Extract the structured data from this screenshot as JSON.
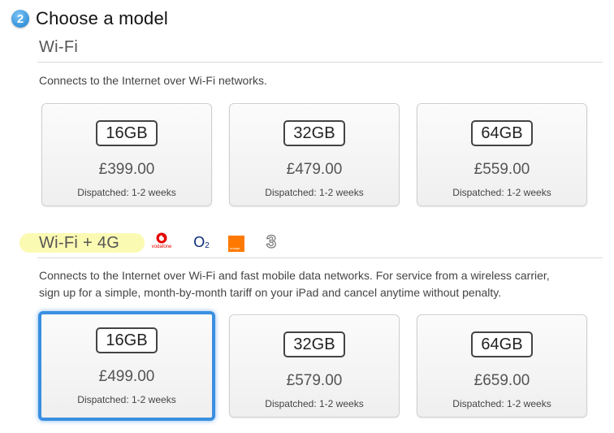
{
  "step": {
    "number": "2",
    "title": "Choose a model"
  },
  "wifi": {
    "title": "Wi-Fi",
    "description": "Connects to the Internet over Wi-Fi networks.",
    "models": [
      {
        "capacity": "16GB",
        "price": "£399.00",
        "dispatch": "Dispatched: 1-2 weeks"
      },
      {
        "capacity": "32GB",
        "price": "£479.00",
        "dispatch": "Dispatched: 1-2 weeks"
      },
      {
        "capacity": "64GB",
        "price": "£559.00",
        "dispatch": "Dispatched: 1-2 weeks"
      }
    ]
  },
  "cellular": {
    "title": "Wi-Fi + 4G",
    "description_line1": "Connects to the Internet over Wi-Fi and fast mobile data networks. For service from a wireless carrier,",
    "description_line2": "sign up for a simple, month-by-month tariff on your iPad and cancel anytime without penalty.",
    "carriers": {
      "vodafone": "vodafone",
      "o2": "O",
      "o2_sub": "2",
      "orange": "orange",
      "three": "3"
    },
    "selected_index": 0,
    "models": [
      {
        "capacity": "16GB",
        "price": "£499.00",
        "dispatch": "Dispatched: 1-2 weeks"
      },
      {
        "capacity": "32GB",
        "price": "£579.00",
        "dispatch": "Dispatched: 1-2 weeks"
      },
      {
        "capacity": "64GB",
        "price": "£659.00",
        "dispatch": "Dispatched: 1-2 weeks"
      }
    ]
  },
  "colors": {
    "selected_border": "#3a8fe0",
    "highlight": "#fbfab2",
    "vodafone_red": "#e60000",
    "o2_blue": "#0a2b7a",
    "orange": "#ff7900"
  }
}
